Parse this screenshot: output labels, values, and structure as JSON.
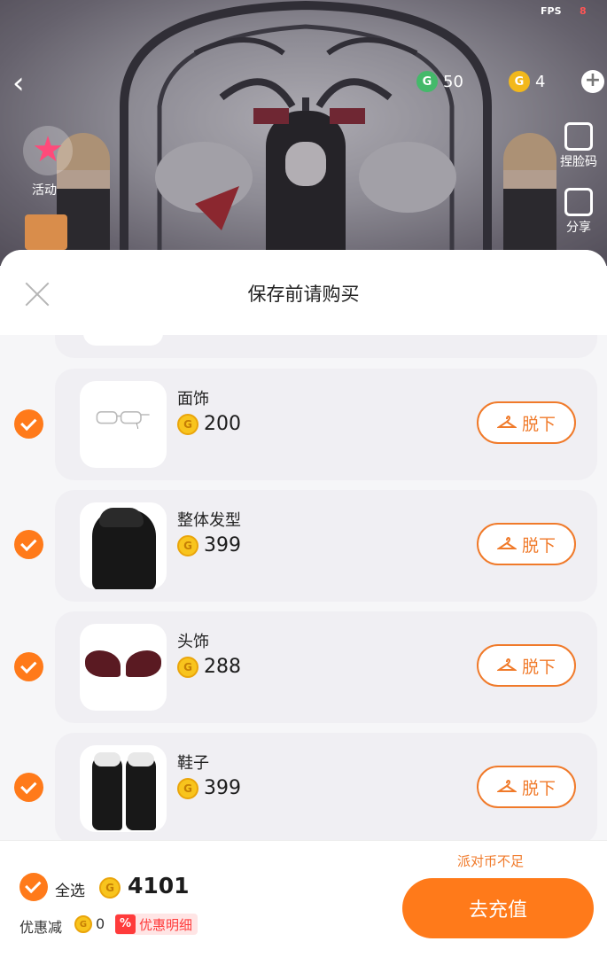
{
  "scene": {
    "fps_label": "FPS",
    "fps_value": "8",
    "currency_green": "50",
    "currency_gold": "4",
    "activity_label": "活动",
    "right_btn_1": "捏脸码",
    "right_btn_2": "分享"
  },
  "sheet": {
    "title": "保存前请购买",
    "items": [
      {
        "name": "面饰",
        "price": "200",
        "button": "脱下",
        "thumb_icon": "glasses-icon"
      },
      {
        "name": "整体发型",
        "price": "399",
        "button": "脱下",
        "thumb_icon": "hair-icon"
      },
      {
        "name": "头饰",
        "price": "288",
        "button": "脱下",
        "thumb_icon": "wings-icon"
      },
      {
        "name": "鞋子",
        "price": "399",
        "button": "脱下",
        "thumb_icon": "boots-icon"
      }
    ]
  },
  "footer": {
    "insufficient": "派对币不足",
    "select_all": "全选",
    "total": "4101",
    "discount_label": "优惠减",
    "discount_value": "0",
    "discount_badge": "%",
    "discount_detail": "优惠明细",
    "recharge": "去充值"
  },
  "colors": {
    "accent": "#ff7a1a",
    "coin": "#f8c41d",
    "discount": "#ff3b3b"
  }
}
